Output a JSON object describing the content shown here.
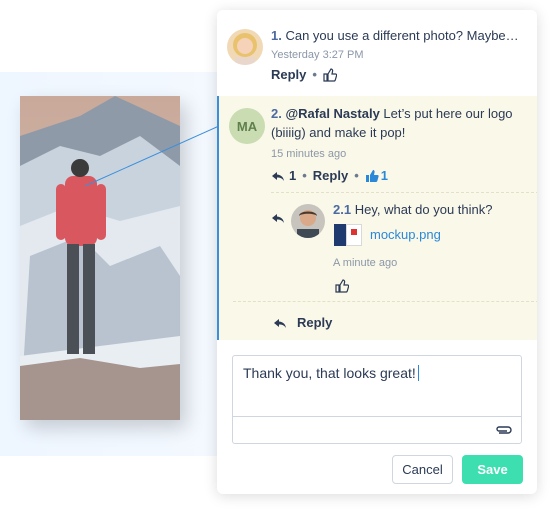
{
  "comments": [
    {
      "number": "1.",
      "text": "Can you use a different photo? Maybe…",
      "time": "Yesterday 3:27 PM",
      "reply_label": "Reply"
    },
    {
      "number": "2.",
      "author_initials": "MA",
      "mention": "@Rafal Nastaly",
      "text_line1_rest": " Let’s put here our logo",
      "text_line2": "(biiiig) and make it pop!",
      "time": "15 minutes ago",
      "reply_count": "1",
      "reply_label": "Reply",
      "like_count": "1"
    }
  ],
  "nested_reply": {
    "number": "2.1",
    "text": "Hey, what do you think?",
    "attachment_name": "mockup.png",
    "time": "A minute ago"
  },
  "thread_reply_label": "Reply",
  "composer": {
    "value": "Thank you, that looks great!"
  },
  "buttons": {
    "cancel": "Cancel",
    "save": "Save"
  },
  "colors": {
    "accent_blue": "#2b88d8",
    "save_green": "#3ddfb1",
    "highlight_bg": "#faf8e9"
  }
}
